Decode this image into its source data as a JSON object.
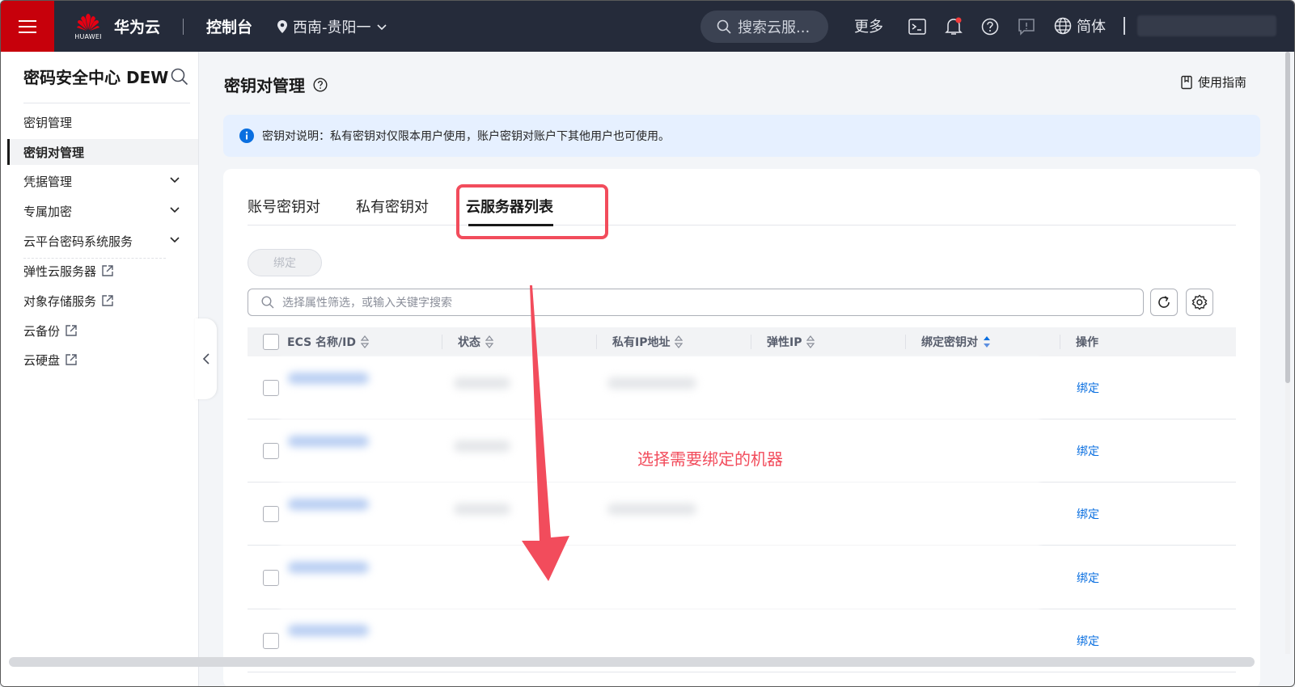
{
  "topbar": {
    "logo_text": "HUAWEI",
    "brand": "华为云",
    "console": "控制台",
    "region": "西南-贵阳一",
    "search_placeholder": "搜索云服...",
    "more": "更多",
    "language": "简体"
  },
  "sidebar": {
    "title": "密码安全中心 DEW",
    "items": [
      {
        "label": "密钥管理",
        "expandable": false,
        "external": false
      },
      {
        "label": "密钥对管理",
        "expandable": false,
        "external": false,
        "active": true
      },
      {
        "label": "凭据管理",
        "expandable": true,
        "external": false
      },
      {
        "label": "专属加密",
        "expandable": true,
        "external": false
      },
      {
        "label": "云平台密码系统服务",
        "expandable": true,
        "external": false
      },
      {
        "label": "弹性云服务器",
        "expandable": false,
        "external": true
      },
      {
        "label": "对象存储服务",
        "expandable": false,
        "external": true
      },
      {
        "label": "云备份",
        "expandable": false,
        "external": true
      },
      {
        "label": "云硬盘",
        "expandable": false,
        "external": true
      }
    ]
  },
  "main": {
    "title": "密钥对管理",
    "guide": "使用指南",
    "info": "密钥对说明：私有密钥对仅限本用户使用，账户密钥对账户下其他用户也可使用。",
    "tabs": [
      "账号密钥对",
      "私有密钥对",
      "云服务器列表"
    ],
    "active_tab": "云服务器列表",
    "bind_button": "绑定",
    "filter_placeholder": "选择属性筛选，或输入关键字搜索",
    "columns": [
      "ECS 名称/ID",
      "状态",
      "私有IP地址",
      "弹性IP",
      "绑定密钥对",
      "操作"
    ],
    "rows": [
      {
        "action": "绑定"
      },
      {
        "action": "绑定"
      },
      {
        "action": "绑定"
      },
      {
        "action": "绑定"
      },
      {
        "action": "绑定"
      }
    ]
  },
  "annotation": {
    "text": "选择需要绑定的机器",
    "color": "#f24c5c"
  },
  "colors": {
    "topbar_bg": "#252b3a",
    "brand_red": "#c7000b",
    "link_blue": "#0a6fe0",
    "info_bg": "#e6f0ff"
  }
}
